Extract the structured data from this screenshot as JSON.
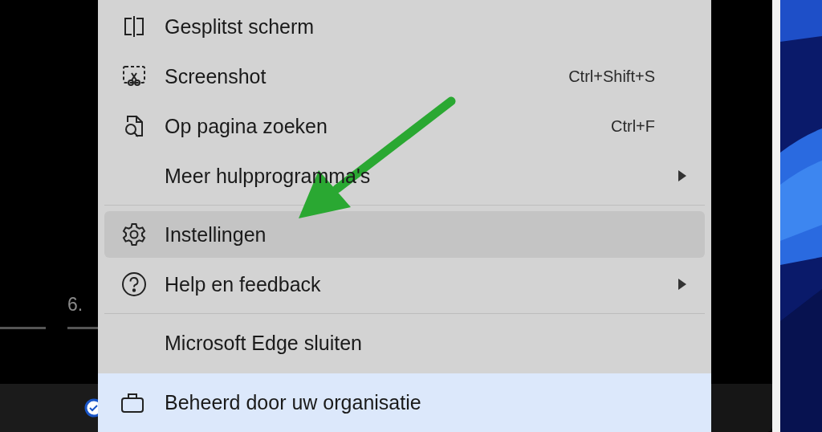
{
  "background": {
    "step_number": "6."
  },
  "menu": {
    "sections": [
      [
        {
          "label": "Gesplitst scherm",
          "selected": false,
          "has_submenu": false
        },
        {
          "label": "Screenshot",
          "shortcut": "Ctrl+Shift+S",
          "selected": false,
          "has_submenu": false
        },
        {
          "label": "Op pagina zoeken",
          "shortcut": "Ctrl+F",
          "selected": false,
          "has_submenu": false
        },
        {
          "label": "Meer hulpprogramma's",
          "selected": false,
          "has_submenu": true
        }
      ],
      [
        {
          "label": "Instellingen",
          "selected": true,
          "has_submenu": false
        },
        {
          "label": "Help en feedback",
          "selected": false,
          "has_submenu": true
        }
      ],
      [
        {
          "label": "Microsoft Edge sluiten",
          "selected": false,
          "has_submenu": false
        }
      ]
    ],
    "footer": {
      "label": "Beheerd door uw organisatie"
    }
  }
}
